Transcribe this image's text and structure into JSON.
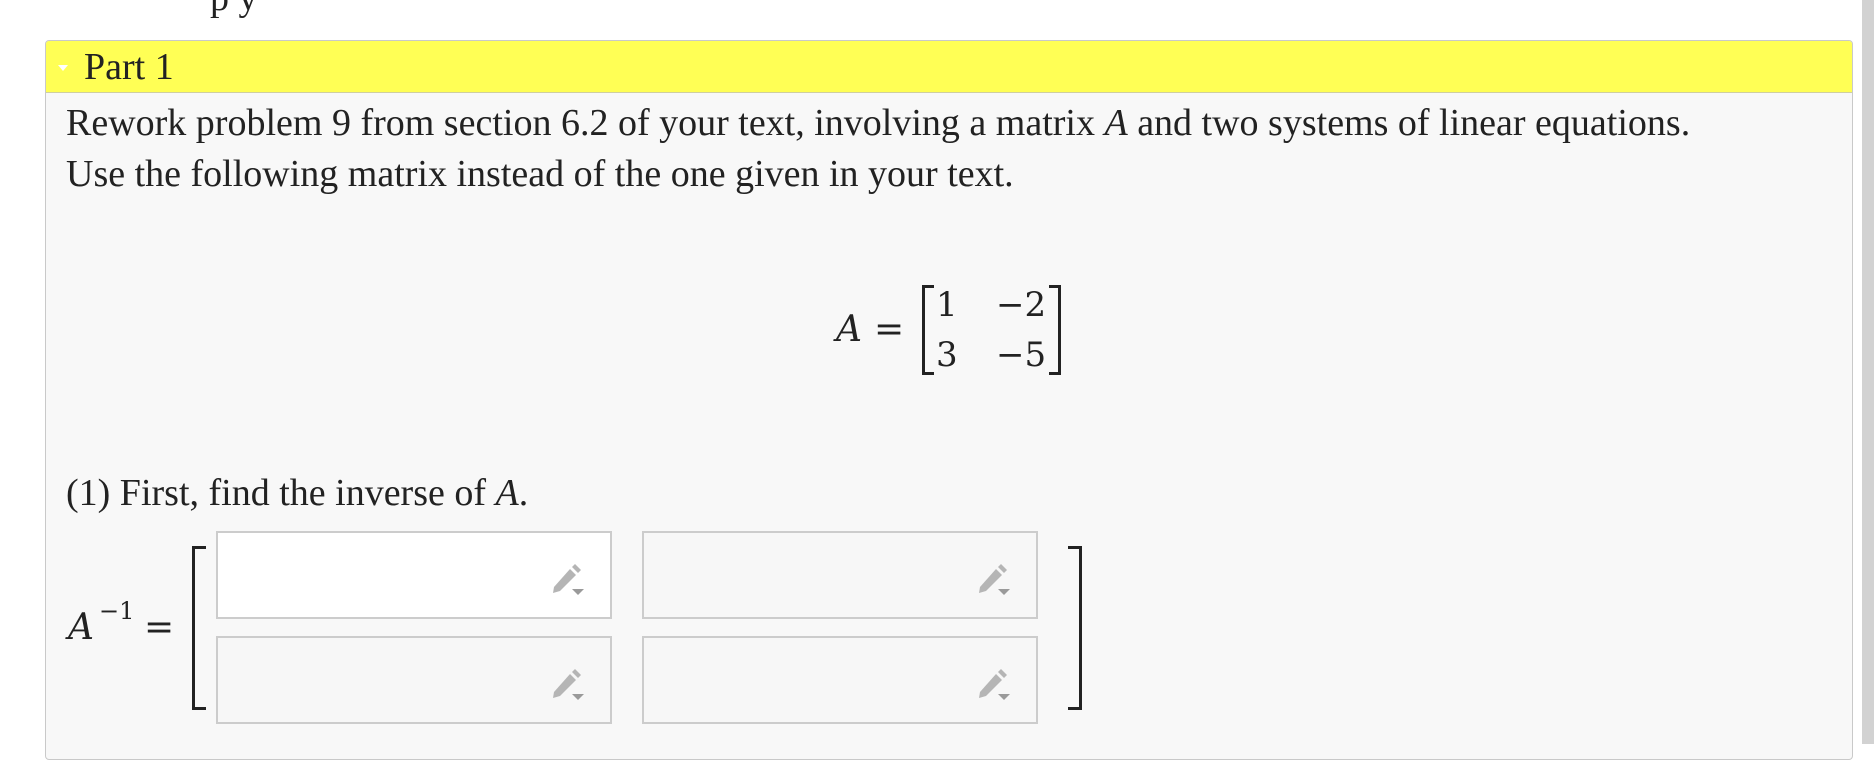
{
  "top_partial_text": "p         y",
  "part": {
    "title": "Part 1",
    "intro_line1_a": "Rework problem 9 from section 6.2 of your text, involving a matrix ",
    "intro_var": "A",
    "intro_line1_b": " and two systems of linear equations.",
    "intro_line2": "Use the following matrix instead of the one given in your text."
  },
  "matrix": {
    "label": "A",
    "equals": "=",
    "entries": [
      [
        "1",
        "−2"
      ],
      [
        "3",
        "−5"
      ]
    ]
  },
  "question1": {
    "prefix": "(1) First, find the inverse of ",
    "var": "A",
    "suffix": "."
  },
  "inverse": {
    "label": "A",
    "exponent": "−1",
    "equals": "=",
    "inputs": [
      {
        "value": "",
        "placeholder": ""
      },
      {
        "value": "",
        "placeholder": ""
      },
      {
        "value": "",
        "placeholder": ""
      },
      {
        "value": "",
        "placeholder": ""
      }
    ]
  },
  "icons": {
    "input_tool": "pencil-dropdown-icon"
  },
  "colors": {
    "header_bg": "#ffff55",
    "panel_bg": "#f8f8f8"
  }
}
